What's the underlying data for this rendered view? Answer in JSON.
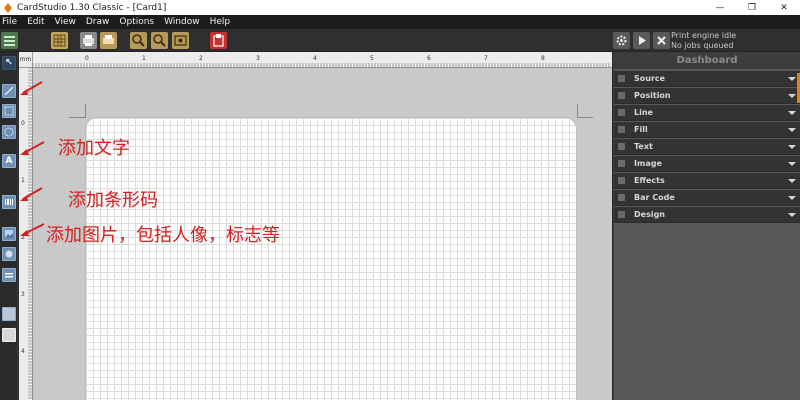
{
  "window": {
    "title": "CardStudio 1.30 Classic - [Card1]",
    "controls": [
      "—",
      "❐",
      "✕"
    ]
  },
  "menu": [
    "File",
    "Edit",
    "View",
    "Draw",
    "Options",
    "Window",
    "Help"
  ],
  "toolbar": {
    "status_line1": "Print engine idle",
    "status_line2": "No jobs queued"
  },
  "ruler": {
    "unit": "mm",
    "top_ticks": [
      "0",
      "1",
      "2",
      "3",
      "4",
      "5",
      "6",
      "7",
      "8"
    ],
    "left_ticks": [
      "0",
      "1",
      "2",
      "3",
      "4"
    ]
  },
  "left_tools": [
    {
      "icon": "pointer-icon",
      "glyph": "↖"
    },
    {
      "icon": "line-tool-icon",
      "glyph": ""
    },
    {
      "icon": "rectangle-tool-icon",
      "glyph": ""
    },
    {
      "icon": "ellipse-tool-icon",
      "glyph": ""
    },
    {
      "icon": "text-tool-icon",
      "glyph": "A"
    },
    {
      "icon": "barcode-tool-icon",
      "glyph": ""
    },
    {
      "icon": "image-tool-icon",
      "glyph": ""
    },
    {
      "icon": "shape-tool-icon",
      "glyph": ""
    },
    {
      "icon": "layer-tool-icon",
      "glyph": ""
    },
    {
      "icon": "layout-tool-icon",
      "glyph": ""
    },
    {
      "icon": "blank-tool-icon",
      "glyph": ""
    }
  ],
  "annotations": {
    "add_text": "添加文字",
    "add_barcode": "添加条形码",
    "add_image": "添加图片，包括人像，标志等"
  },
  "dashboard": {
    "title": "Dashboard",
    "sections": [
      "Source",
      "Position",
      "Line",
      "Fill",
      "Text",
      "Image",
      "Effects",
      "Bar Code",
      "Design"
    ]
  },
  "colors": {
    "annotation_red": "#d42020",
    "accent_orange": "#e0801b",
    "tool_blue": "#6f8fb3"
  }
}
